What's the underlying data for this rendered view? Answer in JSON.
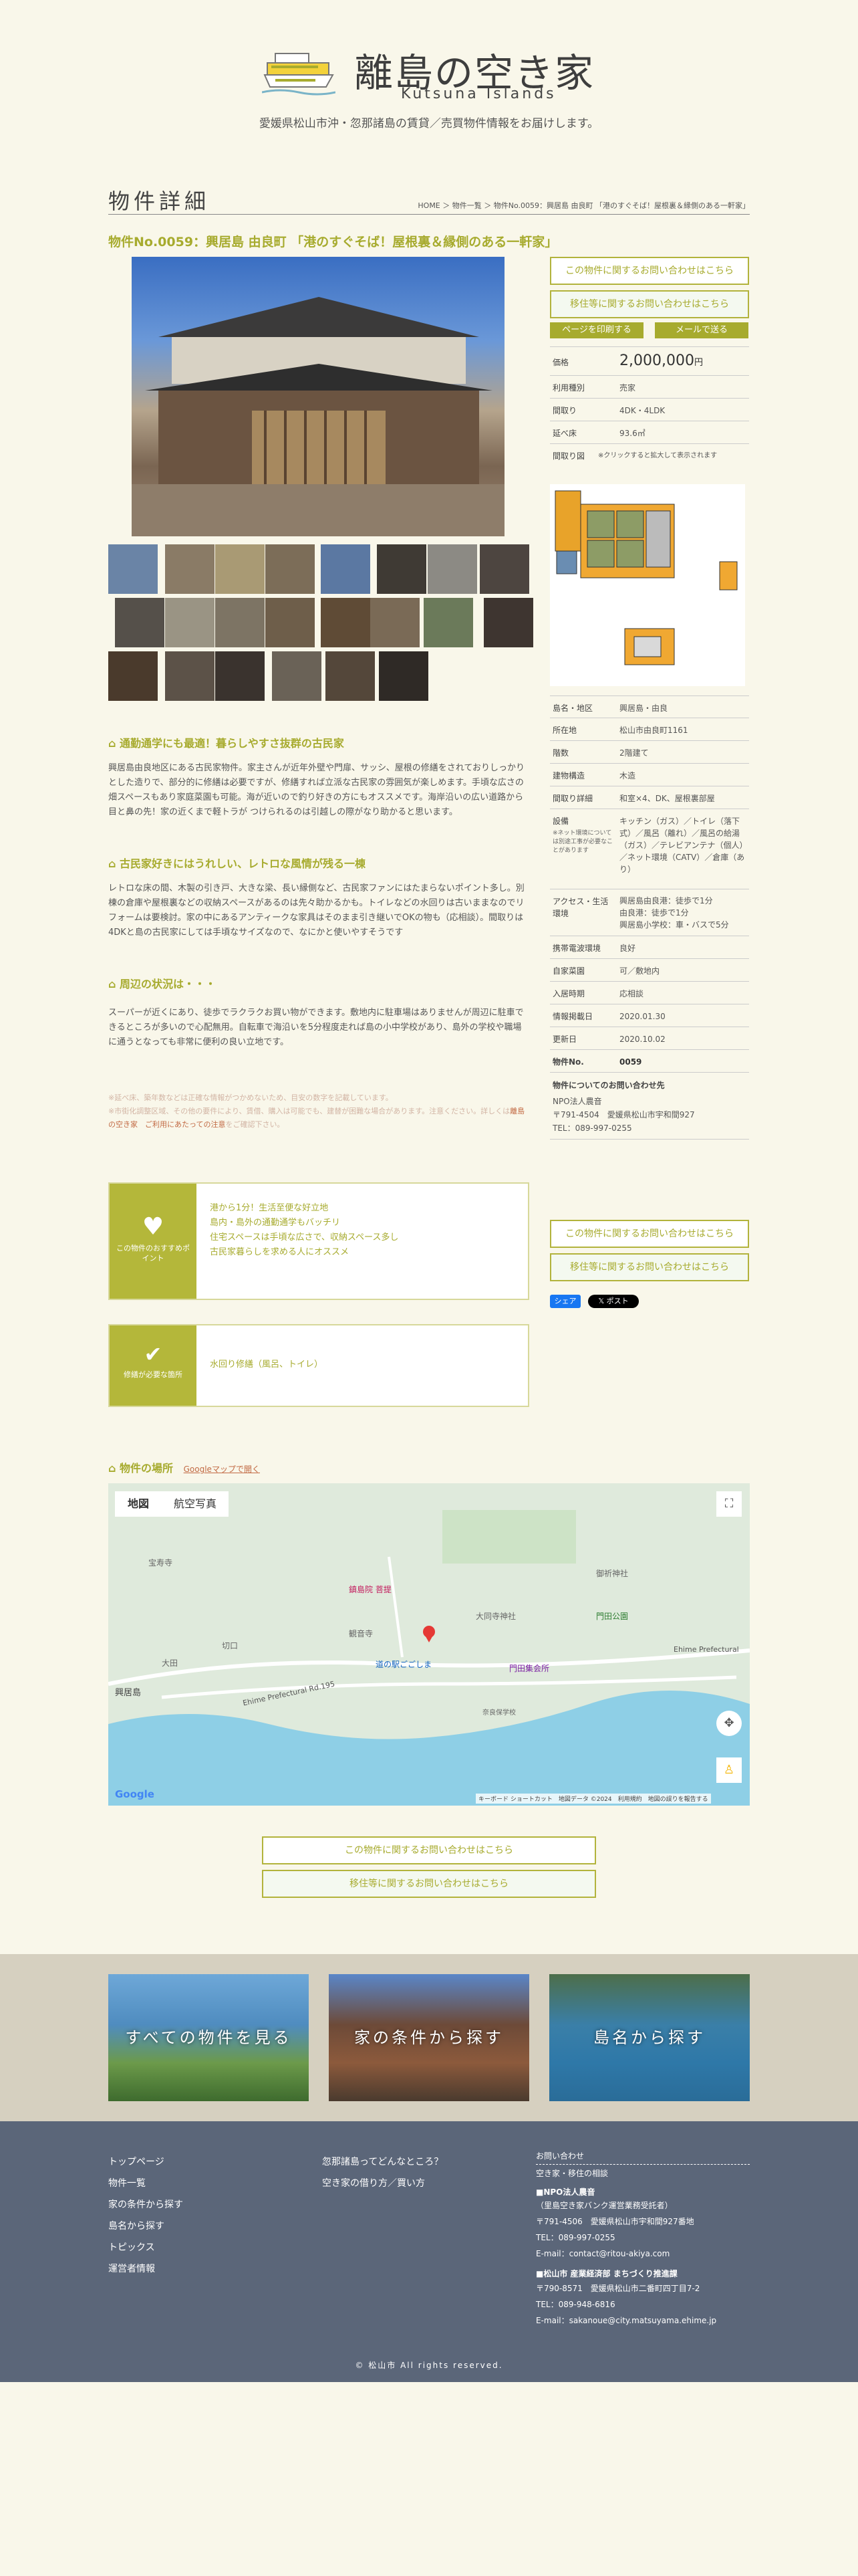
{
  "header": {
    "logo_title": "離島の空き家",
    "logo_sub": "Kutsuna Islands",
    "tagline": "愛媛県松山市沖・忽那諸島の賃貸／売買物件情報をお届けします。"
  },
  "page": {
    "heading": "物件詳細",
    "breadcrumb": "HOME ＞ 物件一覧 ＞ 物件No.0059：興居島 由良町 「港のすぐそば！屋根裏＆縁側のある一軒家」",
    "property_title": "物件No.0059：興居島 由良町 「港のすぐそば！屋根裏＆縁側のある一軒家」"
  },
  "actions": {
    "inquiry_property": "この物件に関するお問い合わせはこちら",
    "inquiry_move": "移住等に関するお問い合わせはこちら",
    "print": "ページを印刷する",
    "mail": "メールで送る"
  },
  "details": {
    "price_label": "価格",
    "price_value": "2,000,000",
    "price_unit": "円",
    "type_label": "利用種別",
    "type_value": "売家",
    "layout_label": "間取り",
    "layout_value": "4DK・4LDK",
    "area_label": "延べ床",
    "area_value": "93.6㎡",
    "floorplan_label": "間取り図",
    "floorplan_note": "※クリックすると拡大して表示されます",
    "island_label": "島名・地区",
    "island_value": "興居島・由良",
    "address_label": "所在地",
    "address_value": "松山市由良町1161",
    "floors_label": "階数",
    "floors_value": "2階建て",
    "structure_label": "建物構造",
    "structure_value": "木造",
    "rooms_label": "間取り詳細",
    "rooms_value": "和室×4、DK、屋根裏部屋",
    "equip_label": "設備",
    "equip_note": "※ネット環境については別途工事が必要なことがあります",
    "equip_value": "キッチン（ガス）／トイレ（落下式）／風呂（離れ）／風呂の給湯（ガス）／テレビアンテナ（個人）／ネット環境（CATV）／倉庫（あり）",
    "access_label": "アクセス・生活環境",
    "access_value": "興居島由良港：徒歩で1分\n由良港：徒歩で1分\n興居島小学校：車・バスで5分",
    "mobile_label": "携帯電波環境",
    "mobile_value": "良好",
    "parking_label": "自家菜園",
    "parking_value": "可／敷地内",
    "move_label": "入居時期",
    "move_value": "応相談",
    "published_label": "情報掲載日",
    "published_value": "2020.01.30",
    "updated_label": "更新日",
    "updated_value": "2020.10.02",
    "no_label": "物件No.",
    "no_value": "0059",
    "contact_title": "物件についてのお問い合わせ先",
    "contact_org": "NPO法人農音",
    "contact_addr": "〒791-4504　愛媛県松山市宇和間927",
    "contact_tel": "TEL：089-997-0255"
  },
  "social": {
    "share": "シェア",
    "post": "ポスト"
  },
  "sections": [
    {
      "heading": "通勤通学にも最適！暮らしやすさ抜群の古民家",
      "body": "興居島由良地区にある古民家物件。家主さんが近年外壁や門扉、サッシ、屋根の修繕をされておりしっかりとした造りで、部分的に修繕は必要ですが、修繕すれば立派な古民家の雰囲気が楽しめます。手頃な広さの畑スペースもあり家庭菜園も可能。海が近いので釣り好きの方にもオススメです。海岸沿いの広い道路から目と鼻の先！家の近くまで軽トラが つけられるのは引越しの際がなり助かると思います。"
    },
    {
      "heading": "古民家好きにはうれしい、レトロな風情が残る一棟",
      "body": "レトロな床の間、木製の引き戸、大きな梁、長い縁側など、古民家ファンにはたまらないポイント多し。別棟の倉庫や屋根裏などの収納スペースがあるのは先々助かるかも。トイレなどの水回りは古いままなのでリフォームは要検討。家の中にあるアンティークな家具はそのまま引き継いでOKの物も（応相談）。間取りは4DKと島の古民家にしては手頃なサイズなので、なにかと使いやすそうです"
    },
    {
      "heading": "周辺の状況は・・・",
      "body": "スーパーが近くにあり、徒歩でラクラクお買い物ができます。敷地内に駐車場はありませんが周辺に駐車できるところが多いので心配無用。自転車で海沿いを5分程度走れば島の小中学校があり、島外の学校や職場に通うとなっても非常に便利の良い立地です。"
    }
  ],
  "notes": {
    "line1": "※延べ床、築年数などは正確な情報がつかめないため、目安の数字を記載しています。",
    "line2": "※市街化調整区域、その他の要件により、賃借、購入は可能でも、建替が困難な場合があります。注意ください。詳しくは",
    "link": "離島の空き家　ご利用にあたっての注意",
    "line3": "をご確認下さい。"
  },
  "points": {
    "label": "この物件のおすすめポイント",
    "lines": [
      "港から1分！生活至便な好立地",
      "島内・島外の通勤通学もバッチリ",
      "住宅スペースは手頃な広さで、収納スペース多し",
      "古民家暮らしを求める人にオススメ"
    ]
  },
  "repairs": {
    "label": "修繕が必要な箇所",
    "text": "水回り修繕（風呂、トイレ）"
  },
  "map": {
    "heading": "物件の場所",
    "google_link": "Googleマップで開く",
    "tab_map": "地図",
    "tab_aerial": "航空写真",
    "labels": [
      "宝寿寺",
      "鎮島院 菩提",
      "観音寺",
      "大田",
      "興居島",
      "大同寺神社",
      "御祈神社",
      "門田公園",
      "門田集会所",
      "道の駅ごごしま",
      "奈良保学校",
      "Ehime Prefectural Rd.195",
      "Ehime Prefectural",
      "切口"
    ],
    "attribution": "キーボード ショートカット　地図データ ©2024　利用規約　地図の誤りを報告する"
  },
  "footer_cards": [
    "すべての物件を見る",
    "家の条件から探す",
    "島名から探す"
  ],
  "footer": {
    "col1": [
      "トップページ",
      "物件一覧",
      "家の条件から探す",
      "島名から探す",
      "トピックス",
      "運営者情報"
    ],
    "col2": [
      "忽那諸島ってどんなところ？",
      "空き家の借り方／買い方"
    ],
    "contact_title": "お問い合わせ",
    "contact_sub": "空き家・移住の相談",
    "org1": "■NPO法人農音",
    "org1_note": "（里島空き家バンク運営業務受託者）",
    "org1_addr": "〒791-4506　愛媛県松山市宇和間927番地",
    "org1_tel": "TEL：089-997-0255",
    "org1_mail": "E-mail：contact@ritou-akiya.com",
    "org2": "■松山市 産業経済部 まちづくり推進課",
    "org2_addr": "〒790-8571　愛媛県松山市二番町四丁目7-2",
    "org2_tel": "TEL：089-948-6816",
    "org2_mail": "E-mail：sakanoue@city.matsuyama.ehime.jp",
    "copyright": "© 松山市 All rights reserved."
  },
  "colors": {
    "accent": "#a7ab2e",
    "footer": "#5b6679",
    "band": "#d6d0c0",
    "bg": "#f9f7ea"
  }
}
